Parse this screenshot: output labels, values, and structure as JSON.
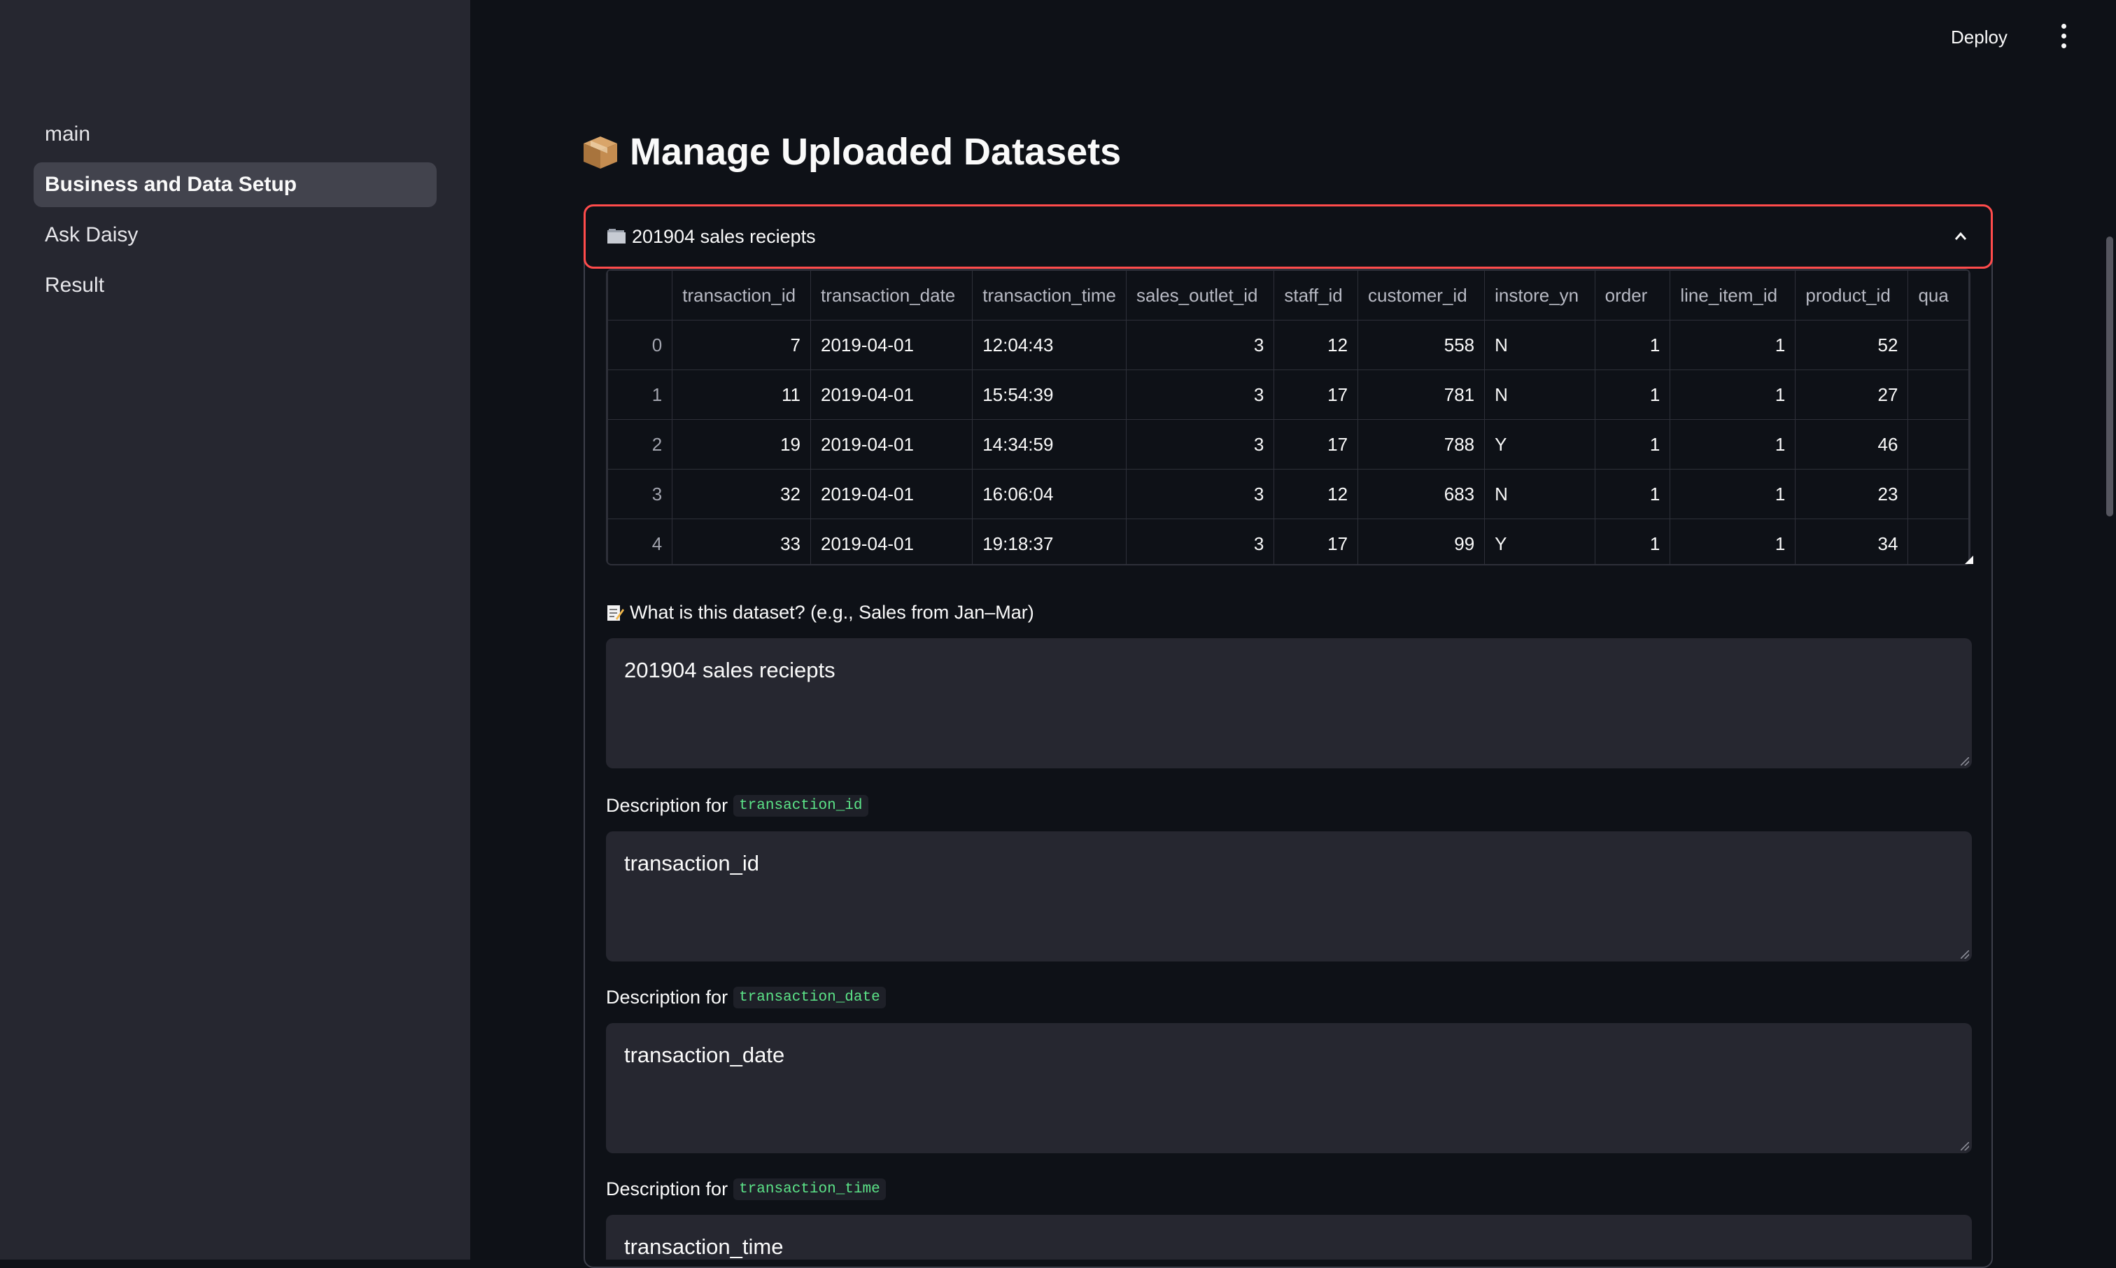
{
  "header": {
    "deploy_label": "Deploy"
  },
  "sidebar": {
    "items": [
      {
        "label": "main"
      },
      {
        "label": "Business and Data Setup",
        "active": true
      },
      {
        "label": "Ask Daisy"
      },
      {
        "label": "Result"
      }
    ]
  },
  "page": {
    "title": "Manage Uploaded Datasets"
  },
  "expander": {
    "title": "201904 sales reciepts"
  },
  "table": {
    "columns": [
      "",
      "transaction_id",
      "transaction_date",
      "transaction_time",
      "sales_outlet_id",
      "staff_id",
      "customer_id",
      "instore_yn",
      "order",
      "line_item_id",
      "product_id",
      "qua"
    ],
    "rows": [
      [
        "0",
        "7",
        "2019-04-01",
        "12:04:43",
        "3",
        "12",
        "558",
        "N",
        "1",
        "1",
        "52",
        ""
      ],
      [
        "1",
        "11",
        "2019-04-01",
        "15:54:39",
        "3",
        "17",
        "781",
        "N",
        "1",
        "1",
        "27",
        ""
      ],
      [
        "2",
        "19",
        "2019-04-01",
        "14:34:59",
        "3",
        "17",
        "788",
        "Y",
        "1",
        "1",
        "46",
        ""
      ],
      [
        "3",
        "32",
        "2019-04-01",
        "16:06:04",
        "3",
        "12",
        "683",
        "N",
        "1",
        "1",
        "23",
        ""
      ],
      [
        "4",
        "33",
        "2019-04-01",
        "19:18:37",
        "3",
        "17",
        "99",
        "Y",
        "1",
        "1",
        "34",
        ""
      ]
    ]
  },
  "dataset_field": {
    "label": "What is this dataset? (e.g., Sales from Jan–Mar)",
    "value": "201904 sales reciepts"
  },
  "descriptions": [
    {
      "prefix": "Description for",
      "column": "transaction_id",
      "value": "transaction_id"
    },
    {
      "prefix": "Description for",
      "column": "transaction_date",
      "value": "transaction_date"
    },
    {
      "prefix": "Description for",
      "column": "transaction_time",
      "value": "transaction_time"
    }
  ],
  "colors": {
    "background": "#0e1117",
    "sidebar": "#262730",
    "accent": "#ff4b4b",
    "code_text": "#5ce488"
  }
}
